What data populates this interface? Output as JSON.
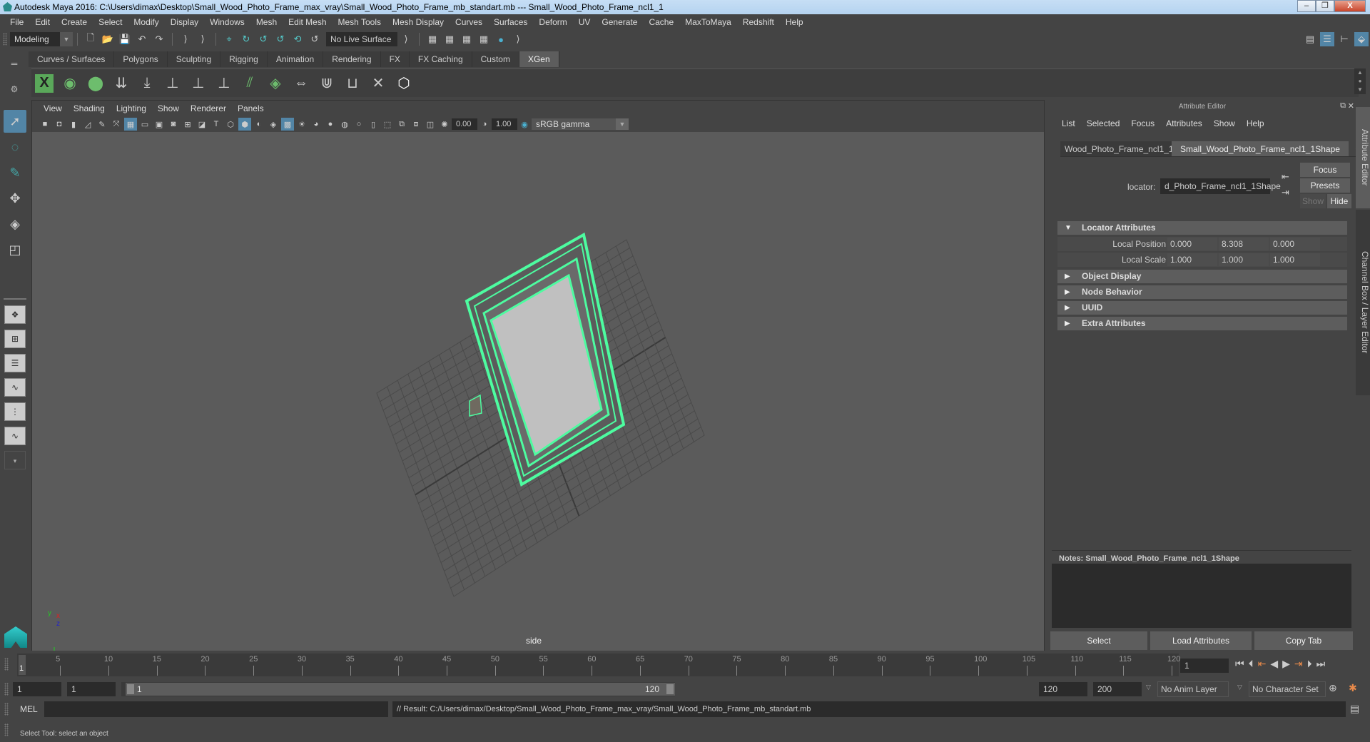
{
  "window": {
    "title": "Autodesk Maya 2016: C:\\Users\\dimax\\Desktop\\Small_Wood_Photo_Frame_max_vray\\Small_Wood_Photo_Frame_mb_standart.mb   ---   Small_Wood_Photo_Frame_ncl1_1",
    "minimize": "–",
    "maximize": "❐",
    "close": "X"
  },
  "menubar": [
    "File",
    "Edit",
    "Create",
    "Select",
    "Modify",
    "Display",
    "Windows",
    "Mesh",
    "Edit Mesh",
    "Mesh Tools",
    "Mesh Display",
    "Curves",
    "Surfaces",
    "Deform",
    "UV",
    "Generate",
    "Cache",
    "MaxToMaya",
    "Redshift",
    "Help"
  ],
  "statusline": {
    "mode": "Modeling",
    "live_surface": "No Live Surface"
  },
  "shelf": {
    "tabs": [
      "Curves / Surfaces",
      "Polygons",
      "Sculpting",
      "Rigging",
      "Animation",
      "Rendering",
      "FX",
      "FX Caching",
      "Custom",
      "XGen"
    ],
    "active_tab": "XGen",
    "icons": [
      "xgen-editor-icon",
      "xgen-preview-icon",
      "xgen-clear-preview-icon",
      "add-guides-icon",
      "place-guide-icon",
      "add-guide-icon",
      "sculpt-guide-icon",
      "lock-guide-icon",
      "split-guide-icon",
      "rebuild-guides-icon",
      "flip-guides-icon",
      "select-guide-icon",
      "guide-region-icon",
      "delete-guides-icon",
      "xgen-interactive-grooming-icon"
    ]
  },
  "viewport": {
    "menu": [
      "View",
      "Shading",
      "Lighting",
      "Show",
      "Renderer",
      "Panels"
    ],
    "exposure": "0.00",
    "gamma": "1.00",
    "color_space": "sRGB gamma",
    "camera_label": "side",
    "axis": {
      "x": "x",
      "y": "y",
      "z": "z"
    },
    "accent_color": "#4dfca0"
  },
  "attribute_editor": {
    "title": "Attribute Editor",
    "menu": [
      "List",
      "Selected",
      "Focus",
      "Attributes",
      "Show",
      "Help"
    ],
    "tabs": [
      "Wood_Photo_Frame_ncl1_1",
      "Small_Wood_Photo_Frame_ncl1_1Shape"
    ],
    "active_tab": "Small_Wood_Photo_Frame_ncl1_1Shape",
    "node_type_label": "locator:",
    "node_name_value": "d_Photo_Frame_ncl1_1Shape",
    "buttons": {
      "focus": "Focus",
      "presets": "Presets",
      "show": "Show",
      "hide": "Hide"
    },
    "sections": [
      {
        "label": "Locator Attributes",
        "expanded": true
      },
      {
        "label": "Object Display",
        "expanded": false
      },
      {
        "label": "Node Behavior",
        "expanded": false
      },
      {
        "label": "UUID",
        "expanded": false
      },
      {
        "label": "Extra Attributes",
        "expanded": false
      }
    ],
    "attributes": [
      {
        "label": "Local Position",
        "values": [
          "0.000",
          "8.308",
          "0.000"
        ]
      },
      {
        "label": "Local Scale",
        "values": [
          "1.000",
          "1.000",
          "1.000"
        ]
      }
    ],
    "notes_label": "Notes:  Small_Wood_Photo_Frame_ncl1_1Shape",
    "bottom_buttons": [
      "Select",
      "Load Attributes",
      "Copy Tab"
    ]
  },
  "side_tabs": [
    "Attribute Editor",
    "Channel Box / Layer Editor"
  ],
  "timeslider": {
    "ticks": [
      "5",
      "10",
      "15",
      "20",
      "25",
      "30",
      "35",
      "40",
      "45",
      "50",
      "55",
      "60",
      "65",
      "70",
      "75",
      "80",
      "85",
      "90",
      "95",
      "100",
      "105",
      "110",
      "115",
      "120"
    ],
    "current_frame_marker": "1",
    "current_frame": "1"
  },
  "range": {
    "start": "1",
    "playback_start": "1",
    "slider_start": "1",
    "slider_end": "120",
    "playback_end": "120",
    "end": "200",
    "anim_layer": "No Anim Layer",
    "character_set": "No Character Set"
  },
  "cmdline": {
    "lang": "MEL",
    "input": "",
    "result": "// Result: C:/Users/dimax/Desktop/Small_Wood_Photo_Frame_max_vray/Small_Wood_Photo_Frame_mb_standart.mb"
  },
  "helpline": "Select Tool: select an object"
}
